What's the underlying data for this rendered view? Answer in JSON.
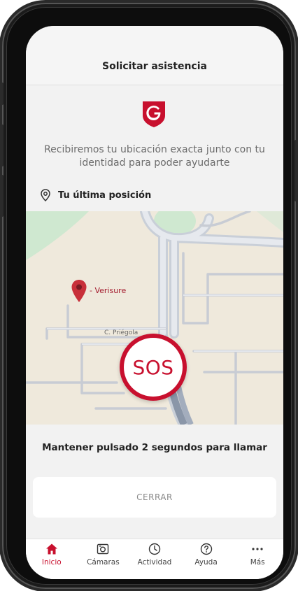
{
  "header": {
    "title": "Solicitar asistencia"
  },
  "brand": {
    "accent": "#c8102e"
  },
  "description": "Recibiremos tu ubicación exacta junto con tu identidad para poder ayudarte",
  "location": {
    "label": "Tu última posición",
    "icon": "location-pin-icon"
  },
  "map": {
    "marker_label": "- Verisure",
    "street_label": "C. Priégola"
  },
  "sos": {
    "label": "SOS"
  },
  "hold_text": "Mantener pulsado 2 segundos para llamar",
  "close_button": {
    "label": "CERRAR"
  },
  "tabs": [
    {
      "label": "Inicio",
      "icon": "home-icon",
      "active": true
    },
    {
      "label": "Cámaras",
      "icon": "camera-icon",
      "active": false
    },
    {
      "label": "Actividad",
      "icon": "clock-icon",
      "active": false
    },
    {
      "label": "Ayuda",
      "icon": "help-icon",
      "active": false
    },
    {
      "label": "Más",
      "icon": "more-icon",
      "active": false
    }
  ]
}
